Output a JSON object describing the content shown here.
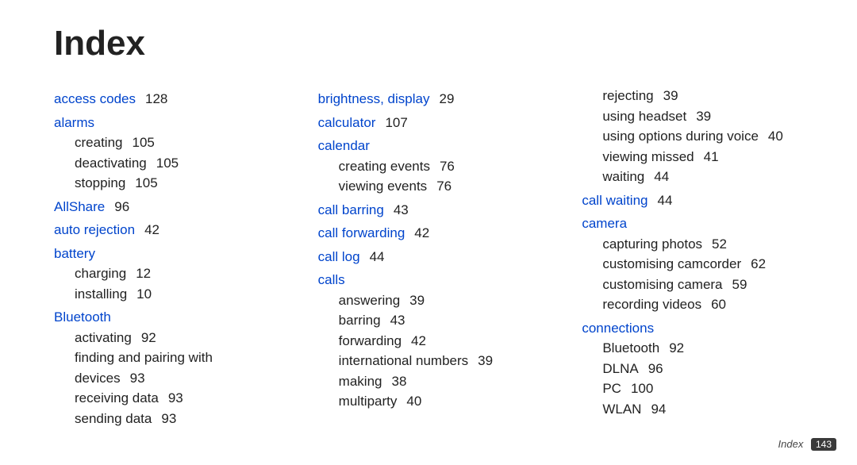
{
  "title": "Index",
  "footer": {
    "label": "Index",
    "page": "143"
  },
  "col1": [
    {
      "type": "main",
      "label": "access codes",
      "page": "128"
    },
    {
      "type": "main",
      "label": "alarms"
    },
    {
      "type": "sub",
      "label": "creating",
      "page": "105"
    },
    {
      "type": "sub",
      "label": "deactivating",
      "page": "105"
    },
    {
      "type": "sub",
      "label": "stopping",
      "page": "105"
    },
    {
      "type": "main",
      "label": "AllShare",
      "page": "96"
    },
    {
      "type": "main",
      "label": "auto rejection",
      "page": "42"
    },
    {
      "type": "main",
      "label": "battery"
    },
    {
      "type": "sub",
      "label": "charging",
      "page": "12"
    },
    {
      "type": "sub",
      "label": "installing",
      "page": "10"
    },
    {
      "type": "main",
      "label": "Bluetooth"
    },
    {
      "type": "sub",
      "label": "activating",
      "page": "92"
    },
    {
      "type": "sub",
      "label": "finding and pairing with devices",
      "page": "93"
    },
    {
      "type": "sub",
      "label": "receiving data",
      "page": "93"
    },
    {
      "type": "sub",
      "label": "sending data",
      "page": "93"
    }
  ],
  "col2": [
    {
      "type": "main",
      "label": "brightness, display",
      "page": "29"
    },
    {
      "type": "main",
      "label": "calculator",
      "page": "107"
    },
    {
      "type": "main",
      "label": "calendar"
    },
    {
      "type": "sub",
      "label": "creating events",
      "page": "76"
    },
    {
      "type": "sub",
      "label": "viewing events",
      "page": "76"
    },
    {
      "type": "main",
      "label": "call barring",
      "page": "43"
    },
    {
      "type": "main",
      "label": "call forwarding",
      "page": "42"
    },
    {
      "type": "main",
      "label": "call log",
      "page": "44"
    },
    {
      "type": "main",
      "label": "calls"
    },
    {
      "type": "sub",
      "label": "answering",
      "page": "39"
    },
    {
      "type": "sub",
      "label": "barring",
      "page": "43"
    },
    {
      "type": "sub",
      "label": "forwarding",
      "page": "42"
    },
    {
      "type": "sub",
      "label": "international numbers",
      "page": "39"
    },
    {
      "type": "sub",
      "label": "making",
      "page": "38"
    },
    {
      "type": "sub",
      "label": "multiparty",
      "page": "40"
    }
  ],
  "col3": [
    {
      "type": "sub",
      "label": "rejecting",
      "page": "39"
    },
    {
      "type": "sub",
      "label": "using headset",
      "page": "39"
    },
    {
      "type": "sub",
      "label": "using options during voice",
      "page": "40"
    },
    {
      "type": "sub",
      "label": "viewing missed",
      "page": "41"
    },
    {
      "type": "sub",
      "label": "waiting",
      "page": "44"
    },
    {
      "type": "main",
      "label": "call waiting",
      "page": "44"
    },
    {
      "type": "main",
      "label": "camera"
    },
    {
      "type": "sub",
      "label": "capturing photos",
      "page": "52"
    },
    {
      "type": "sub",
      "label": "customising camcorder",
      "page": "62"
    },
    {
      "type": "sub",
      "label": "customising camera",
      "page": "59"
    },
    {
      "type": "sub",
      "label": "recording videos",
      "page": "60"
    },
    {
      "type": "main",
      "label": "connections"
    },
    {
      "type": "sub",
      "label": "Bluetooth",
      "page": "92"
    },
    {
      "type": "sub",
      "label": "DLNA",
      "page": "96"
    },
    {
      "type": "sub",
      "label": "PC",
      "page": "100"
    },
    {
      "type": "sub",
      "label": "WLAN",
      "page": "94"
    }
  ]
}
